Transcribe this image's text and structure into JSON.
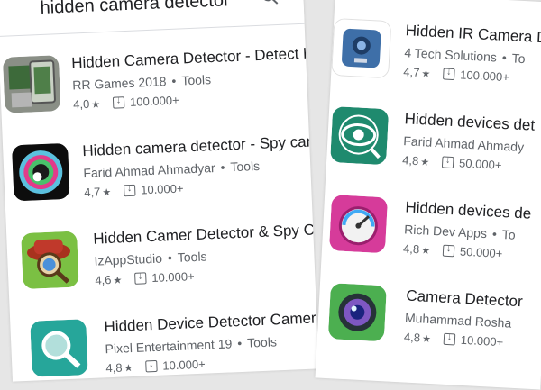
{
  "search": {
    "query": "hidden camera detector"
  },
  "left_list": [
    {
      "name": "Hidden Camera Detector - Detect Hi",
      "developer": "RR Games 2018",
      "category": "Tools",
      "rating": "4,0",
      "downloads": "100.000+",
      "icon": "camera-cube-icon"
    },
    {
      "name": "Hidden camera detector - Spy came",
      "developer": "Farid Ahmad Ahmadyar",
      "category": "Tools",
      "rating": "4,7",
      "downloads": "10.000+",
      "icon": "lens-rings-icon"
    },
    {
      "name": "Hidden Camer Detector & Spy Came",
      "developer": "IzAppStudio",
      "category": "Tools",
      "rating": "4,6",
      "downloads": "10.000+",
      "icon": "detective-magnifier-icon"
    },
    {
      "name": "Hidden Device Detector Camera and",
      "developer": "Pixel Entertainment 19",
      "category": "Tools",
      "rating": "4,8",
      "downloads": "10.000+",
      "icon": "magnifier-teal-icon"
    }
  ],
  "right_list": [
    {
      "name": "Hidden IR Camera De",
      "developer": "4 Tech Solutions",
      "category": "To",
      "rating": "4,7",
      "downloads": "100.000+",
      "icon": "ir-camera-icon"
    },
    {
      "name": "Hidden devices det",
      "developer": "Farid Ahmad Ahmady",
      "category": "",
      "rating": "4,8",
      "downloads": "50.000+",
      "icon": "eye-magnifier-icon"
    },
    {
      "name": "Hidden devices de",
      "developer": "Rich Dev Apps",
      "category": "To",
      "rating": "4,8",
      "downloads": "50.000+",
      "icon": "gauge-meter-icon"
    },
    {
      "name": "Camera Detector",
      "developer": "Muhammad Rosha",
      "category": "",
      "rating": "4,8",
      "downloads": "10.000+",
      "icon": "camera-lens-icon"
    }
  ]
}
